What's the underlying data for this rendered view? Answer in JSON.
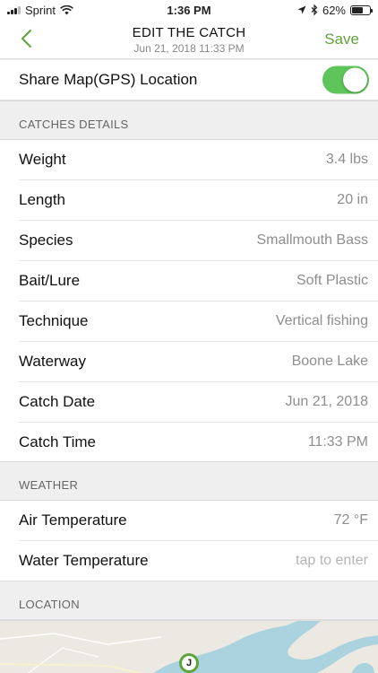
{
  "status_bar": {
    "carrier": "Sprint",
    "time": "1:36 PM",
    "battery": "62%",
    "battery_level": 0.62
  },
  "nav": {
    "title": "EDIT THE CATCH",
    "subtitle": "Jun 21, 2018 11:33 PM",
    "save_label": "Save",
    "back_icon": "chevron-left-icon"
  },
  "share": {
    "label": "Share Map(GPS) Location",
    "enabled": true
  },
  "details": {
    "header": "CATCHES DETAILS",
    "rows": [
      {
        "label": "Weight",
        "value": "3.4 lbs"
      },
      {
        "label": "Length",
        "value": "20 in"
      },
      {
        "label": "Species",
        "value": "Smallmouth Bass"
      },
      {
        "label": "Bait/Lure",
        "value": "Soft Plastic"
      },
      {
        "label": "Technique",
        "value": "Vertical fishing"
      },
      {
        "label": "Waterway",
        "value": "Boone Lake"
      },
      {
        "label": "Catch Date",
        "value": "Jun 21, 2018"
      },
      {
        "label": "Catch Time",
        "value": "11:33 PM"
      }
    ]
  },
  "weather": {
    "header": "WEATHER",
    "rows": [
      {
        "label": "Air Temperature",
        "value": "72 °F"
      },
      {
        "label": "Water Temperature",
        "placeholder": "tap to enter"
      }
    ]
  },
  "location": {
    "header": "LOCATION",
    "pin_letter": "J"
  },
  "colors": {
    "accent": "#5fa43b",
    "toggle_on": "#5ec55a",
    "water": "#aad3df",
    "land": "#ece9e2"
  }
}
